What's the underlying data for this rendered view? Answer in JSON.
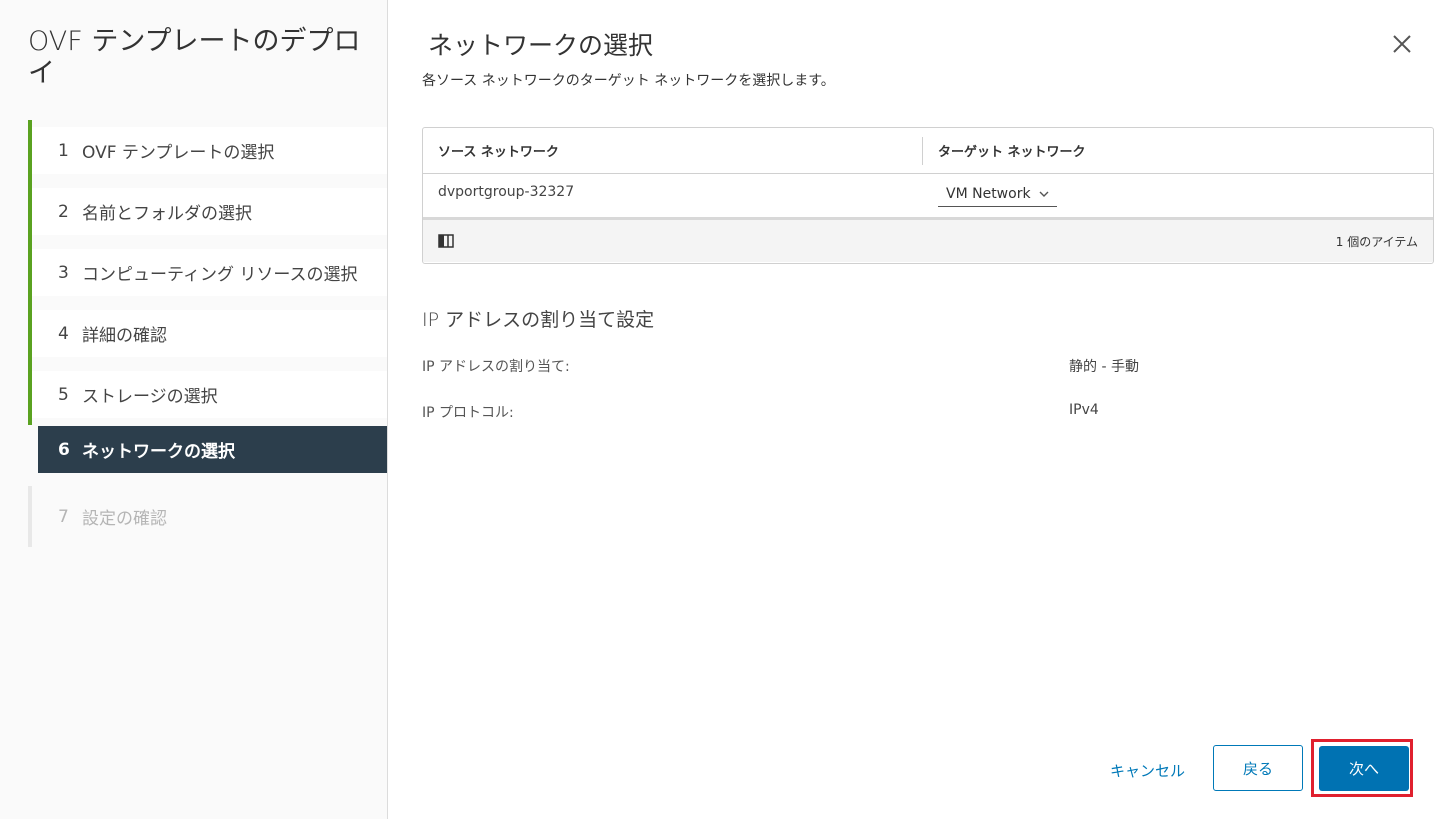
{
  "sidebar": {
    "title": "OVF テンプレートのデプロイ",
    "steps": [
      {
        "num": "1",
        "label": "OVF テンプレートの選択"
      },
      {
        "num": "2",
        "label": "名前とフォルダの選択"
      },
      {
        "num": "3",
        "label": "コンピューティング リソースの選択"
      },
      {
        "num": "4",
        "label": "詳細の確認"
      },
      {
        "num": "5",
        "label": "ストレージの選択"
      },
      {
        "num": "6",
        "label": "ネットワークの選択"
      },
      {
        "num": "7",
        "label": "設定の確認"
      }
    ]
  },
  "main": {
    "title": "ネットワークの選択",
    "subtitle": "各ソース ネットワークのターゲット ネットワークを選択します。",
    "grid": {
      "headers": [
        "ソース ネットワーク",
        "ターゲット ネットワーク"
      ],
      "rows": [
        {
          "source": "dvportgroup-32327",
          "target": "VM Network"
        }
      ],
      "footer_count": "1 個のアイテム"
    },
    "ip_section": {
      "title": "IP アドレスの割り当て設定",
      "items": [
        {
          "label": "IP アドレスの割り当て:",
          "value": "静的 - 手動"
        },
        {
          "label": "IP プロトコル:",
          "value": "IPv4"
        }
      ]
    }
  },
  "footer": {
    "cancel": "キャンセル",
    "back": "戻る",
    "next": "次へ"
  },
  "colors": {
    "accent": "#0072b2",
    "complete_bar": "#5aa220",
    "active_step": "#2c3e4c",
    "highlight": "#e0202e"
  }
}
